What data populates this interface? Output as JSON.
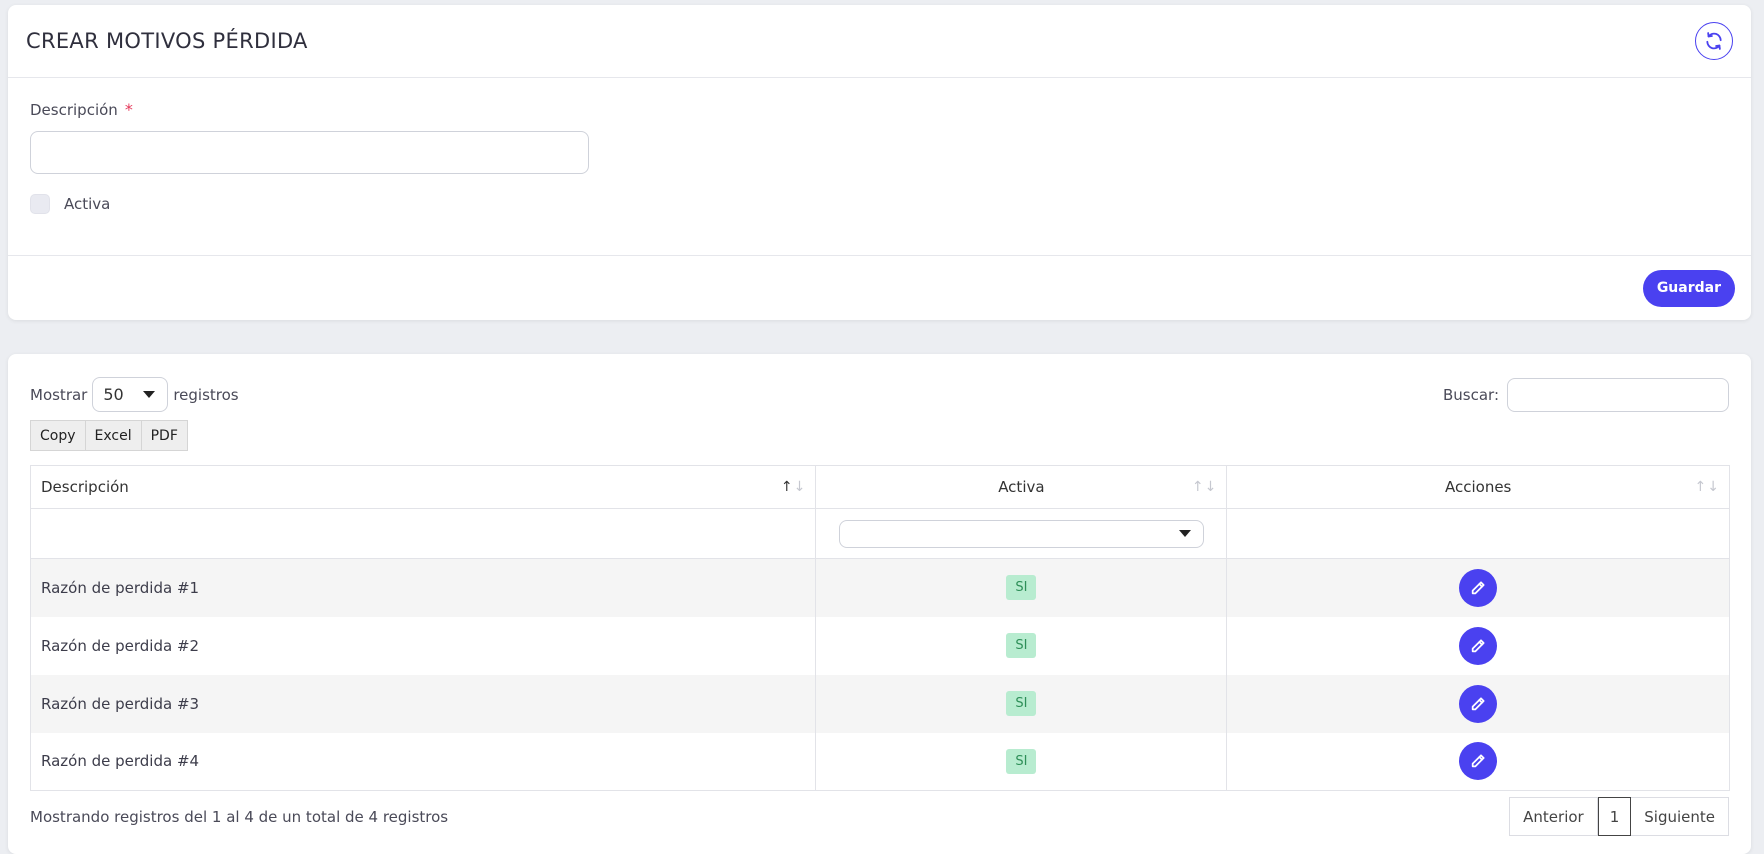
{
  "header": {
    "title": "CREAR MOTIVOS PÉRDIDA"
  },
  "form": {
    "description_label": "Descripción",
    "required_mark": "*",
    "description_value": "",
    "active_label": "Activa",
    "save_label": "Guardar"
  },
  "table_controls": {
    "show_label": "Mostrar",
    "page_length": "50",
    "records_label": "registros",
    "search_label": "Buscar:",
    "export_buttons": [
      "Copy",
      "Excel",
      "PDF"
    ]
  },
  "table": {
    "columns": [
      "Descripción",
      "Activa",
      "Acciones"
    ],
    "rows": [
      {
        "description": "Razón de perdida #1",
        "active": "SI"
      },
      {
        "description": "Razón de perdida #2",
        "active": "SI"
      },
      {
        "description": "Razón de perdida #3",
        "active": "SI"
      },
      {
        "description": "Razón de perdida #4",
        "active": "SI"
      }
    ]
  },
  "footer": {
    "info": "Mostrando registros del 1 al 4 de un total de 4 registros",
    "prev_label": "Anterior",
    "current_page": "1",
    "next_label": "Siguiente"
  },
  "colors": {
    "accent": "#4a41f0",
    "badge_bg": "#b8ecd0",
    "badge_text": "#2e8f58",
    "required": "#e5395b"
  },
  "icons": {
    "refresh": "refresh-icon",
    "edit": "pencil-icon",
    "dropdown": "caret-down-icon",
    "sort": "sort-arrows-icon"
  }
}
